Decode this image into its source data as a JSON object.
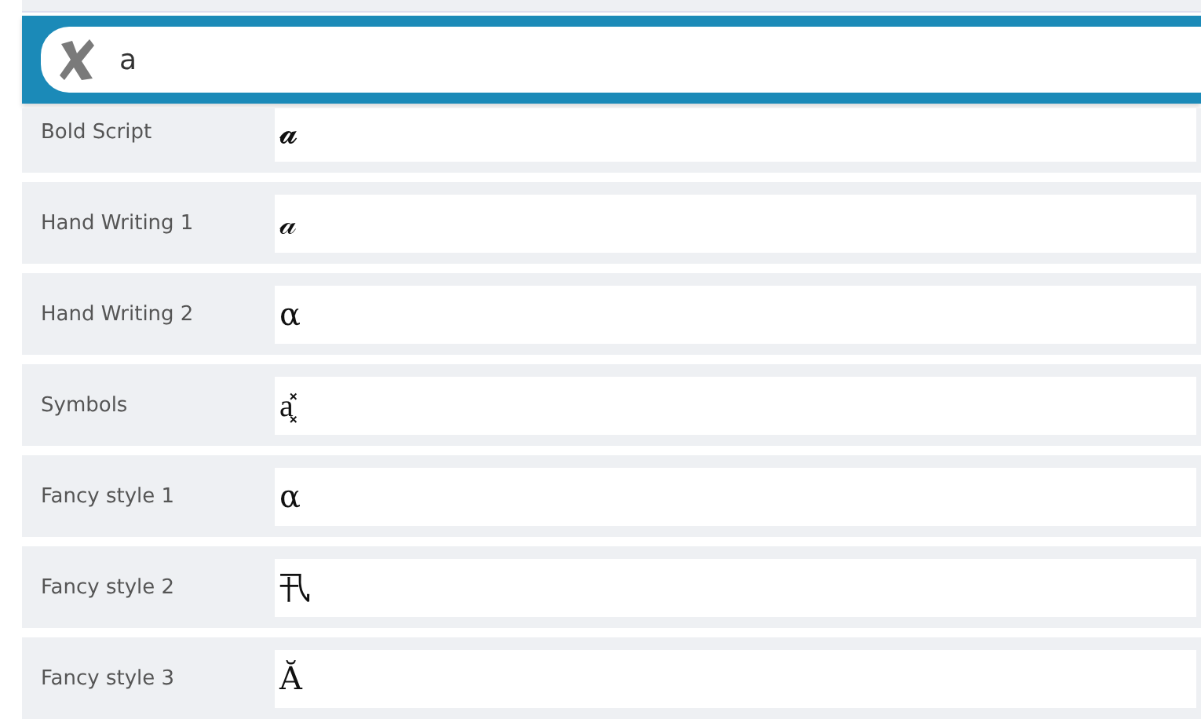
{
  "search": {
    "value": "a"
  },
  "rows": [
    {
      "label": "Bold Script",
      "value": "𝓪"
    },
    {
      "label": "Hand Writing 1",
      "value": "𝒶"
    },
    {
      "label": "Hand Writing 2",
      "value": "α"
    },
    {
      "label": "Symbols",
      "value": "a͓̽"
    },
    {
      "label": "Fancy style 1",
      "value": "α"
    },
    {
      "label": "Fancy style 2",
      "value": "卂"
    },
    {
      "label": "Fancy style 3",
      "value": "Ă"
    }
  ]
}
